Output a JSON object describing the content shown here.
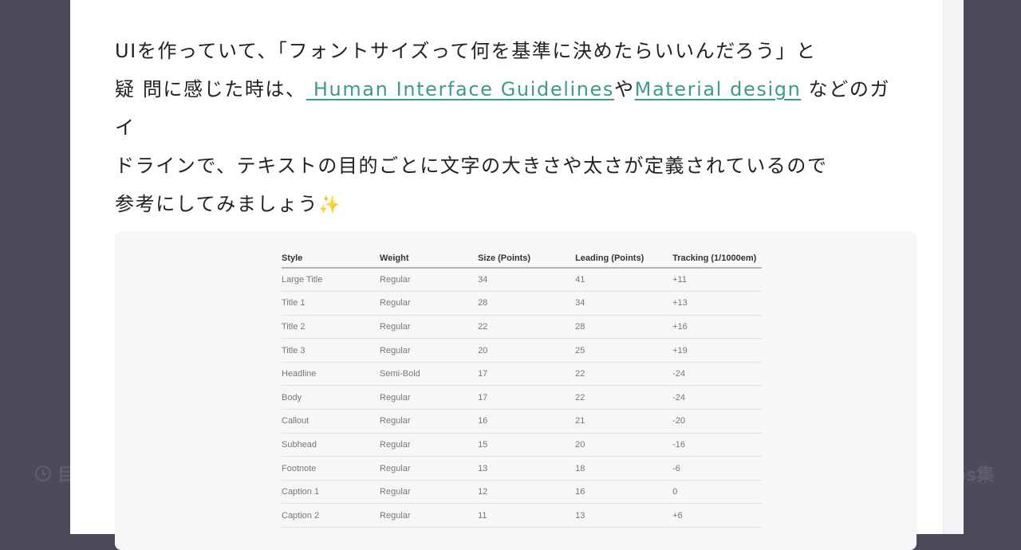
{
  "background": {
    "left_text": "目",
    "right_text": "os集"
  },
  "article": {
    "line1": "UIを作っていて、「フォントサイズって何を基準に決めたらいいんだろう」と",
    "line2_prefix": "疑 問に感じた時は、",
    "link1": " Human Interface Guidelines",
    "connector": "や",
    "link2": "Material design",
    "line2_suffix": " などのガイ",
    "line3": "ドラインで、テキストの目的ごとに文字の大きさや太さが定義されているので",
    "line4": "参考にしてみましょう",
    "sparkle": "✨"
  },
  "table": {
    "headers": [
      "Style",
      "Weight",
      "Size (Points)",
      "Leading (Points)",
      "Tracking (1/1000em)"
    ],
    "rows": [
      [
        "Large Title",
        "Regular",
        "34",
        "41",
        "+11"
      ],
      [
        "Title 1",
        "Regular",
        "28",
        "34",
        "+13"
      ],
      [
        "Title 2",
        "Regular",
        "22",
        "28",
        "+16"
      ],
      [
        "Title 3",
        "Regular",
        "20",
        "25",
        "+19"
      ],
      [
        "Headline",
        "Semi-Bold",
        "17",
        "22",
        "-24"
      ],
      [
        "Body",
        "Regular",
        "17",
        "22",
        "-24"
      ],
      [
        "Callout",
        "Regular",
        "16",
        "21",
        "-20"
      ],
      [
        "Subhead",
        "Regular",
        "15",
        "20",
        "-16"
      ],
      [
        "Footnote",
        "Regular",
        "13",
        "18",
        "-6"
      ],
      [
        "Caption 1",
        "Regular",
        "12",
        "16",
        "0"
      ],
      [
        "Caption 2",
        "Regular",
        "11",
        "13",
        "+6"
      ]
    ]
  },
  "colors": {
    "overlay": "#4b4b5b",
    "link": "#3c9c8c",
    "text": "#222222"
  }
}
